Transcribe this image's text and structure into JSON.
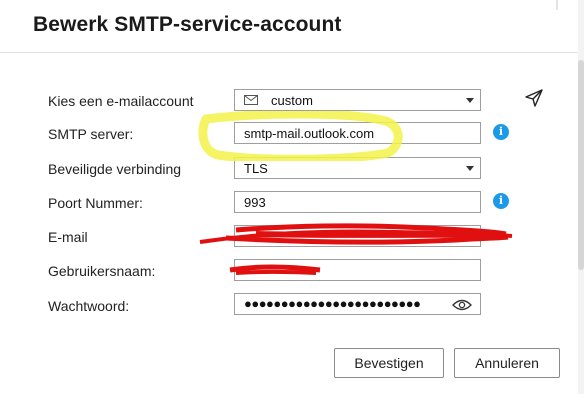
{
  "dialog": {
    "title": "Bewerk SMTP-service-account"
  },
  "form": {
    "email_account": {
      "label": "Kies een e-mailaccount",
      "value": "custom"
    },
    "smtp_server": {
      "label": "SMTP server:",
      "value": "smtp-mail.outlook.com"
    },
    "secure_connection": {
      "label": "Beveiligde verbinding",
      "value": "TLS"
    },
    "port": {
      "label": "Poort Nummer:",
      "value": "993"
    },
    "email": {
      "label": "E-mail",
      "value": ""
    },
    "username": {
      "label": "Gebruikersnaam:",
      "value": ""
    },
    "password": {
      "label": "Wachtwoord:",
      "masked_value": "●●●●●●●●●●●●●●●●●●●●●●●●"
    }
  },
  "buttons": {
    "confirm": "Bevestigen",
    "cancel": "Annuleren"
  },
  "icons": {
    "account": "envelope-icon",
    "test": "paper-plane-icon",
    "info": "info-icon",
    "reveal": "eye-icon"
  },
  "colors": {
    "info_blue": "#1a9ae8",
    "highlight_yellow": "#f2f24a",
    "redaction_red": "#e01010"
  }
}
